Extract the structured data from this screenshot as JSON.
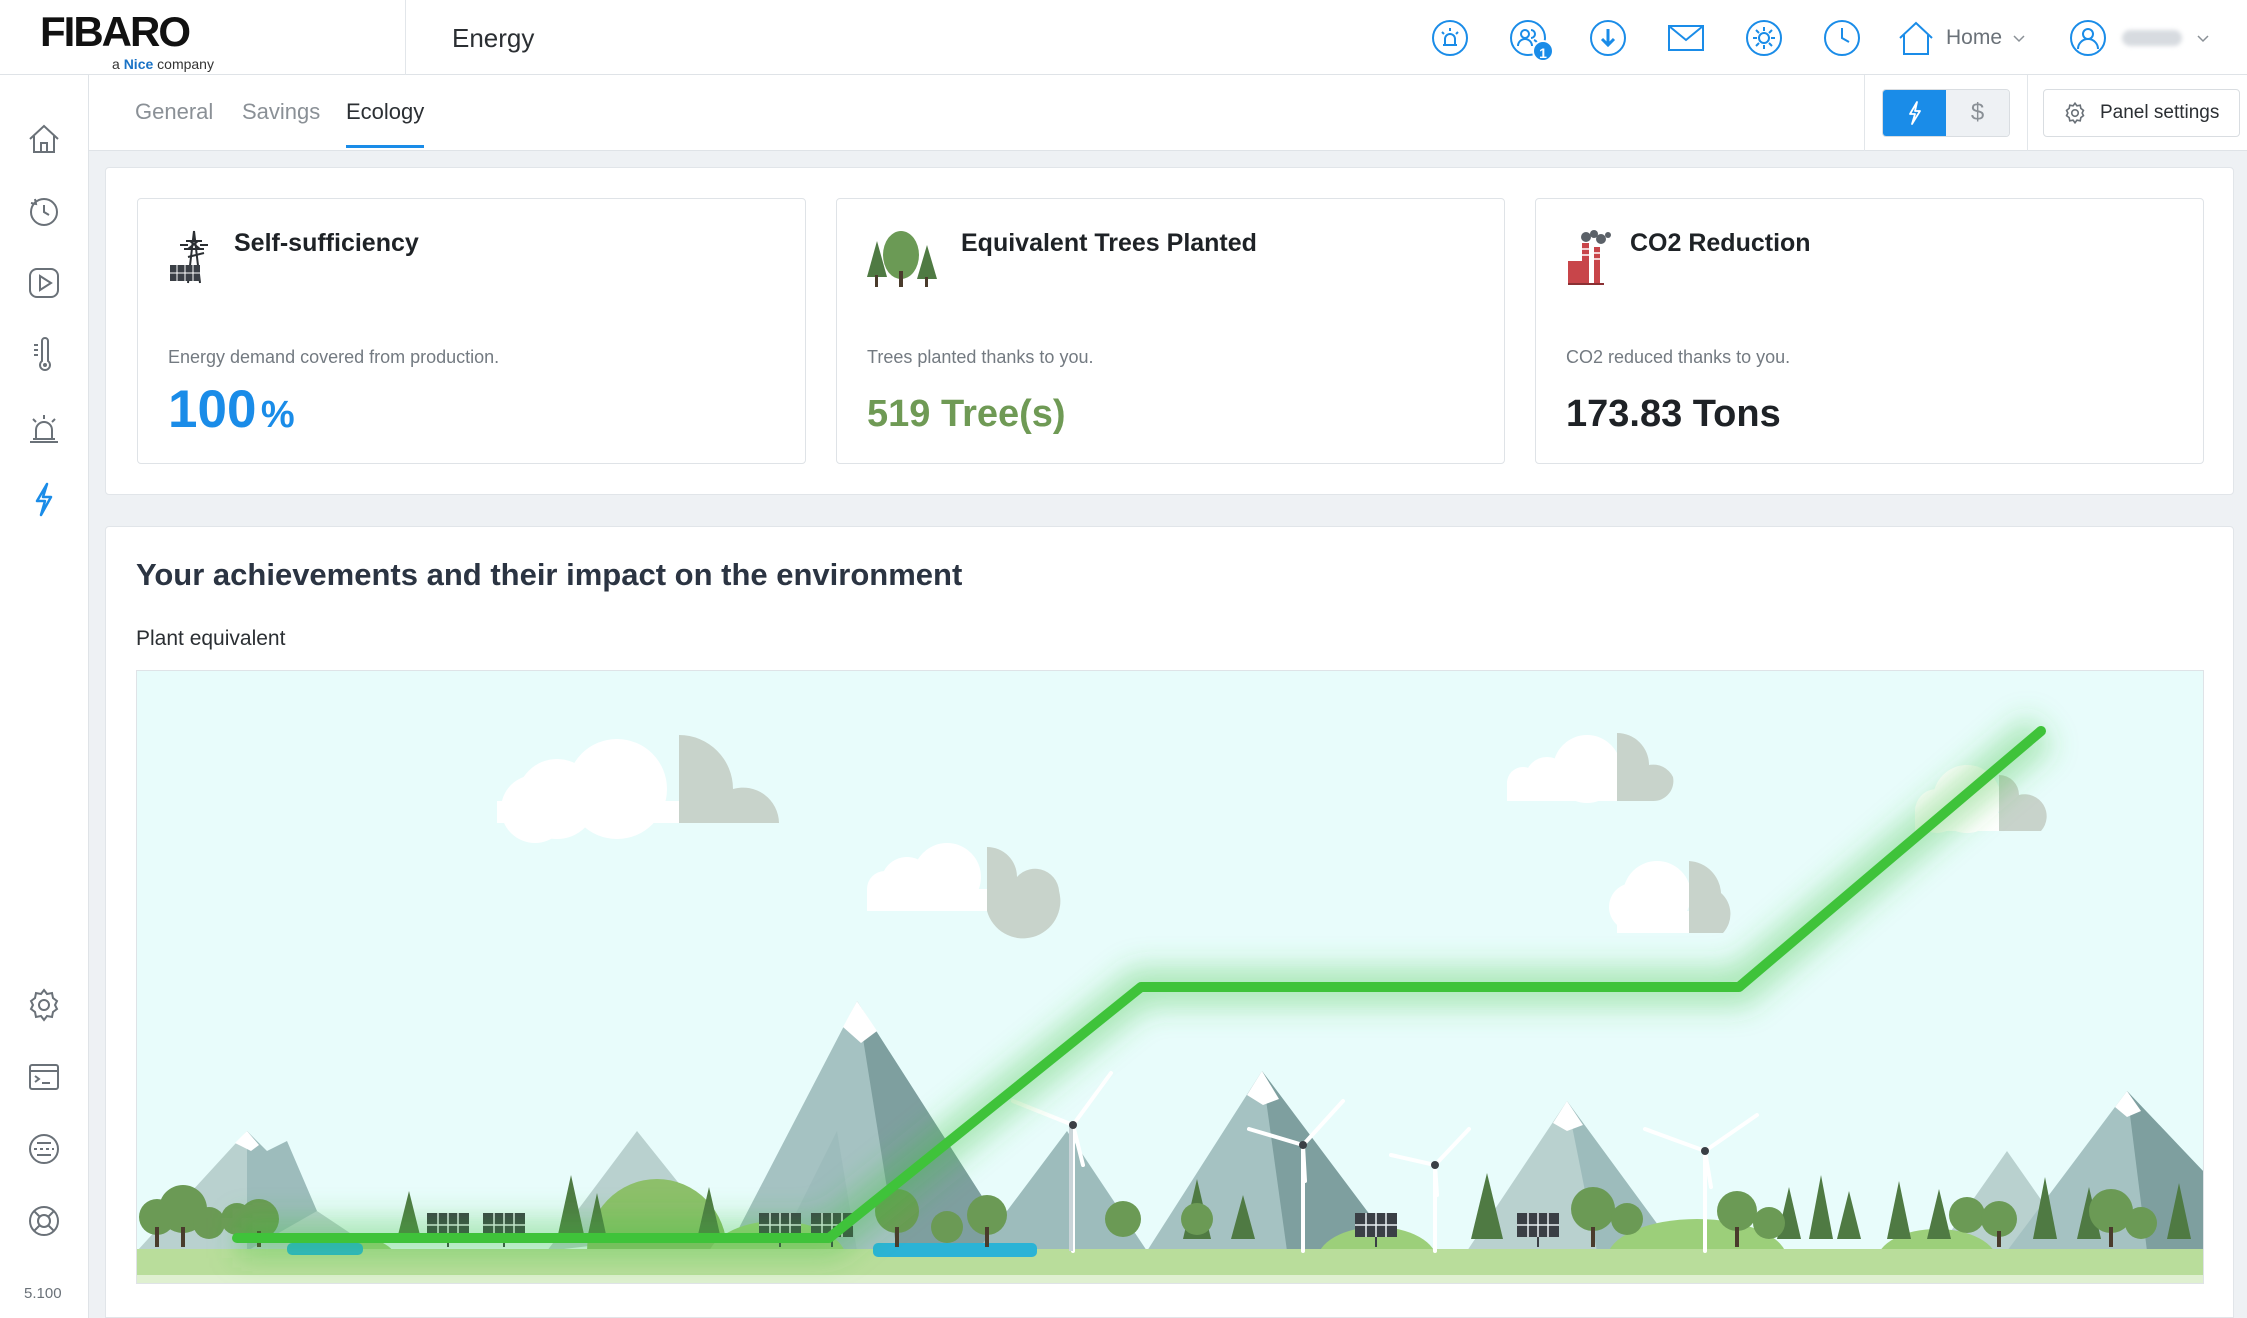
{
  "header": {
    "logo_text": "FIBARO",
    "logo_sub_prefix": "a ",
    "logo_sub_brand": "Nice",
    "logo_sub_suffix": " company",
    "page_title": "Energy",
    "notification_count": "1",
    "home_label": "Home",
    "user_name": "",
    "icons": [
      "alarm-icon",
      "users-icon",
      "download-icon",
      "mail-icon",
      "sun-icon",
      "clock-icon",
      "home-icon",
      "user-icon"
    ]
  },
  "sidebar": {
    "items": [
      "home-icon",
      "history-icon",
      "scenes-icon",
      "climate-icon",
      "alarm-icon",
      "energy-icon"
    ],
    "bottom_items": [
      "settings-icon",
      "terminal-icon",
      "network-icon",
      "support-icon"
    ],
    "version": "5.100"
  },
  "tabs": [
    {
      "label": "General",
      "active": false
    },
    {
      "label": "Savings",
      "active": false
    },
    {
      "label": "Ecology",
      "active": true
    }
  ],
  "toolbar": {
    "energy_toggle_icon": "lightning-icon",
    "currency_toggle": "$",
    "panel_settings_label": "Panel settings"
  },
  "cards": {
    "self_sufficiency": {
      "title": "Self-sufficiency",
      "description": "Energy demand covered from production.",
      "value": "100",
      "unit": "%",
      "color": "#1a8ce8"
    },
    "trees": {
      "title": "Equivalent Trees Planted",
      "description": "Trees planted thanks to you.",
      "value": "519 Tree(s)",
      "color": "#6f9a55"
    },
    "co2": {
      "title": "CO2 Reduction",
      "description": "CO2 reduced thanks to you.",
      "value": "173.83 Tons",
      "color": "#1e2226"
    }
  },
  "achievements": {
    "title": "Your achievements and their impact on the environment",
    "subtitle": "Plant equivalent",
    "line_color": "#3fc33a"
  }
}
